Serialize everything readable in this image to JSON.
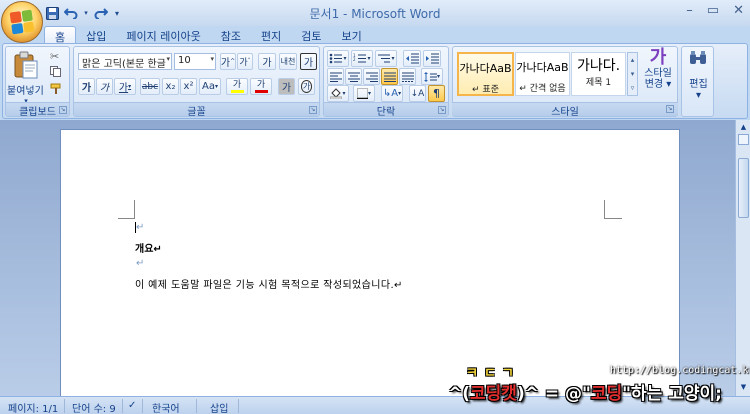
{
  "window": {
    "title": "문서1 - Microsoft Word"
  },
  "tabs": [
    "홈",
    "삽입",
    "페이지 레이아웃",
    "참조",
    "편지",
    "검토",
    "보기"
  ],
  "groups": {
    "clipboard": {
      "label": "클립보드",
      "paste": "붙여넣기"
    },
    "font": {
      "label": "글꼴",
      "font_name": "맑은 고딕(본문 한글",
      "font_size": "10"
    },
    "paragraph": {
      "label": "단락"
    },
    "styles": {
      "label": "스타일",
      "items": [
        {
          "sample": "가나다AaB",
          "name": "↵ 표준"
        },
        {
          "sample": "가나다AaB",
          "name": "↵ 간격 없음"
        },
        {
          "sample": "가나다.",
          "name": "제목 1"
        }
      ],
      "change_styles": "스타일\n변경",
      "change_styles_a": "스타일",
      "change_styles_b": "변경"
    },
    "editing": {
      "label": "편집"
    }
  },
  "font_buttons": {
    "grow": "가",
    "shrink": "가",
    "clear": "가",
    "phonetic": "내천",
    "border": "가",
    "bold": "가",
    "italic": "가",
    "underline": "가",
    "strike": "abc",
    "subscript": "x₂",
    "superscript": "x²",
    "case": "Aa",
    "highlight": "가",
    "fontcolor": "가",
    "charshade": "가",
    "encircle": "가"
  },
  "document": {
    "lines": [
      {
        "text": "↵"
      },
      {
        "text": "개요↵"
      },
      {
        "text": "↵"
      },
      {
        "text": "이 예제 도움말 파일은 기능 시험 목적으로 작성되었습니다.↵"
      }
    ]
  },
  "status": {
    "page": "페이지: 1/1",
    "words": "단어 수: 9",
    "language": "한국어",
    "mode": "삽입"
  },
  "watermark": {
    "url": "http://blog.codingcat.kr/",
    "sub": "ㅋㄷㄱ",
    "main_a": "^(",
    "main_b": "코딩캣",
    "main_c": ")^ = @\"",
    "main_d": "코딩",
    "main_e": "\"하는 고양이;"
  },
  "colors": {
    "highlight": "#ffff00",
    "fontcolor": "#e00000",
    "accent": "#15428b"
  }
}
